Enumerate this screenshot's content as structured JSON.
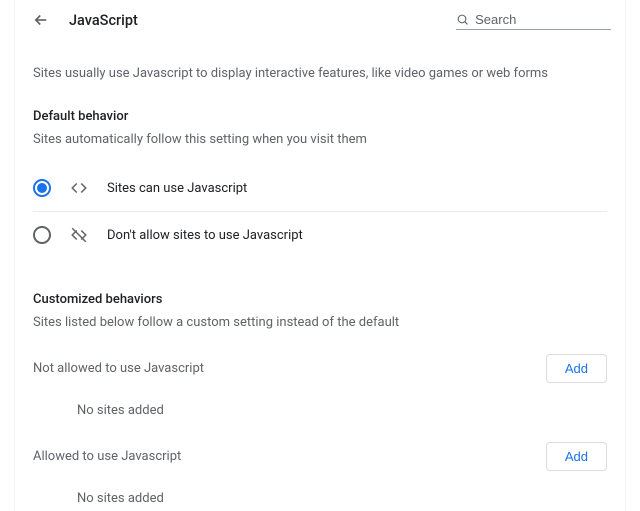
{
  "header": {
    "title": "JavaScript",
    "search_placeholder": "Search"
  },
  "intro": "Sites usually use Javascript to display interactive features, like video games or web forms",
  "default_behavior": {
    "heading": "Default behavior",
    "sub": "Sites automatically follow this setting when you visit them",
    "options": [
      {
        "label": "Sites can use Javascript",
        "selected": true,
        "icon": "code-icon"
      },
      {
        "label": "Don't allow sites to use Javascript",
        "selected": false,
        "icon": "code-off-icon"
      }
    ]
  },
  "customized": {
    "heading": "Customized behaviors",
    "sub": "Sites listed below follow a custom setting instead of the default",
    "add_label": "Add",
    "not_allowed": {
      "title": "Not allowed to use Javascript",
      "empty": "No sites added"
    },
    "allowed": {
      "title": "Allowed to use Javascript",
      "empty": "No sites added"
    }
  }
}
